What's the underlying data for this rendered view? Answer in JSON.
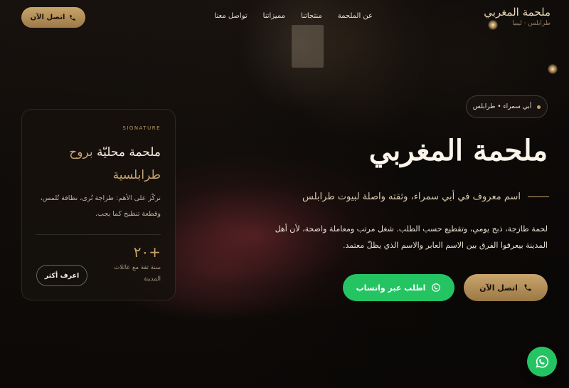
{
  "brand": {
    "title": "ملحمة المغربي",
    "subtitle": "طرابلس · ليبيا"
  },
  "nav": {
    "links": [
      "عن الملحمة",
      "منتجاتنا",
      "مميزاتنا",
      "تواصل معنا"
    ],
    "cta_label": "اتصل الآن"
  },
  "hero": {
    "location": "أبي سمراء • طرابلس",
    "title": "ملحمة المغربي",
    "subtitle": "اسم معروف في أبي سمراء، وثقته واصلة لبيوت طرابلس",
    "description": "لحمة طازجة، ذبح يومي، وتقطيع حسب الطلب. شغل مرتب ومعاملة واضحة، لأن أهل المدينة بيعرفوا الفرق بين الاسم العابر والاسم الذي يظلّ معتمد.",
    "call_label": "اتصل الآن",
    "whatsapp_label": "اطلب عبر واتساب"
  },
  "card": {
    "eyebrow": "SIGNATURE",
    "title_main": "ملحمة محليّة ",
    "title_gold": "بروح",
    "title_end": "طرابلسية",
    "text": "نركّز على الأهم: طزاجة تُرى، نظافة تُلمس، وقطعة تنطبخ كما يجب.",
    "stat_number": "+٢٠",
    "stat_label": "سنة ثقة مع عائلات المدينة",
    "more_label": "اعرف أكثر"
  },
  "colors": {
    "gold": "#c9a46c",
    "whatsapp": "#25c463",
    "background": "#120e0b"
  },
  "icons": {
    "phone": "phone-icon",
    "whatsapp": "whatsapp-icon"
  }
}
